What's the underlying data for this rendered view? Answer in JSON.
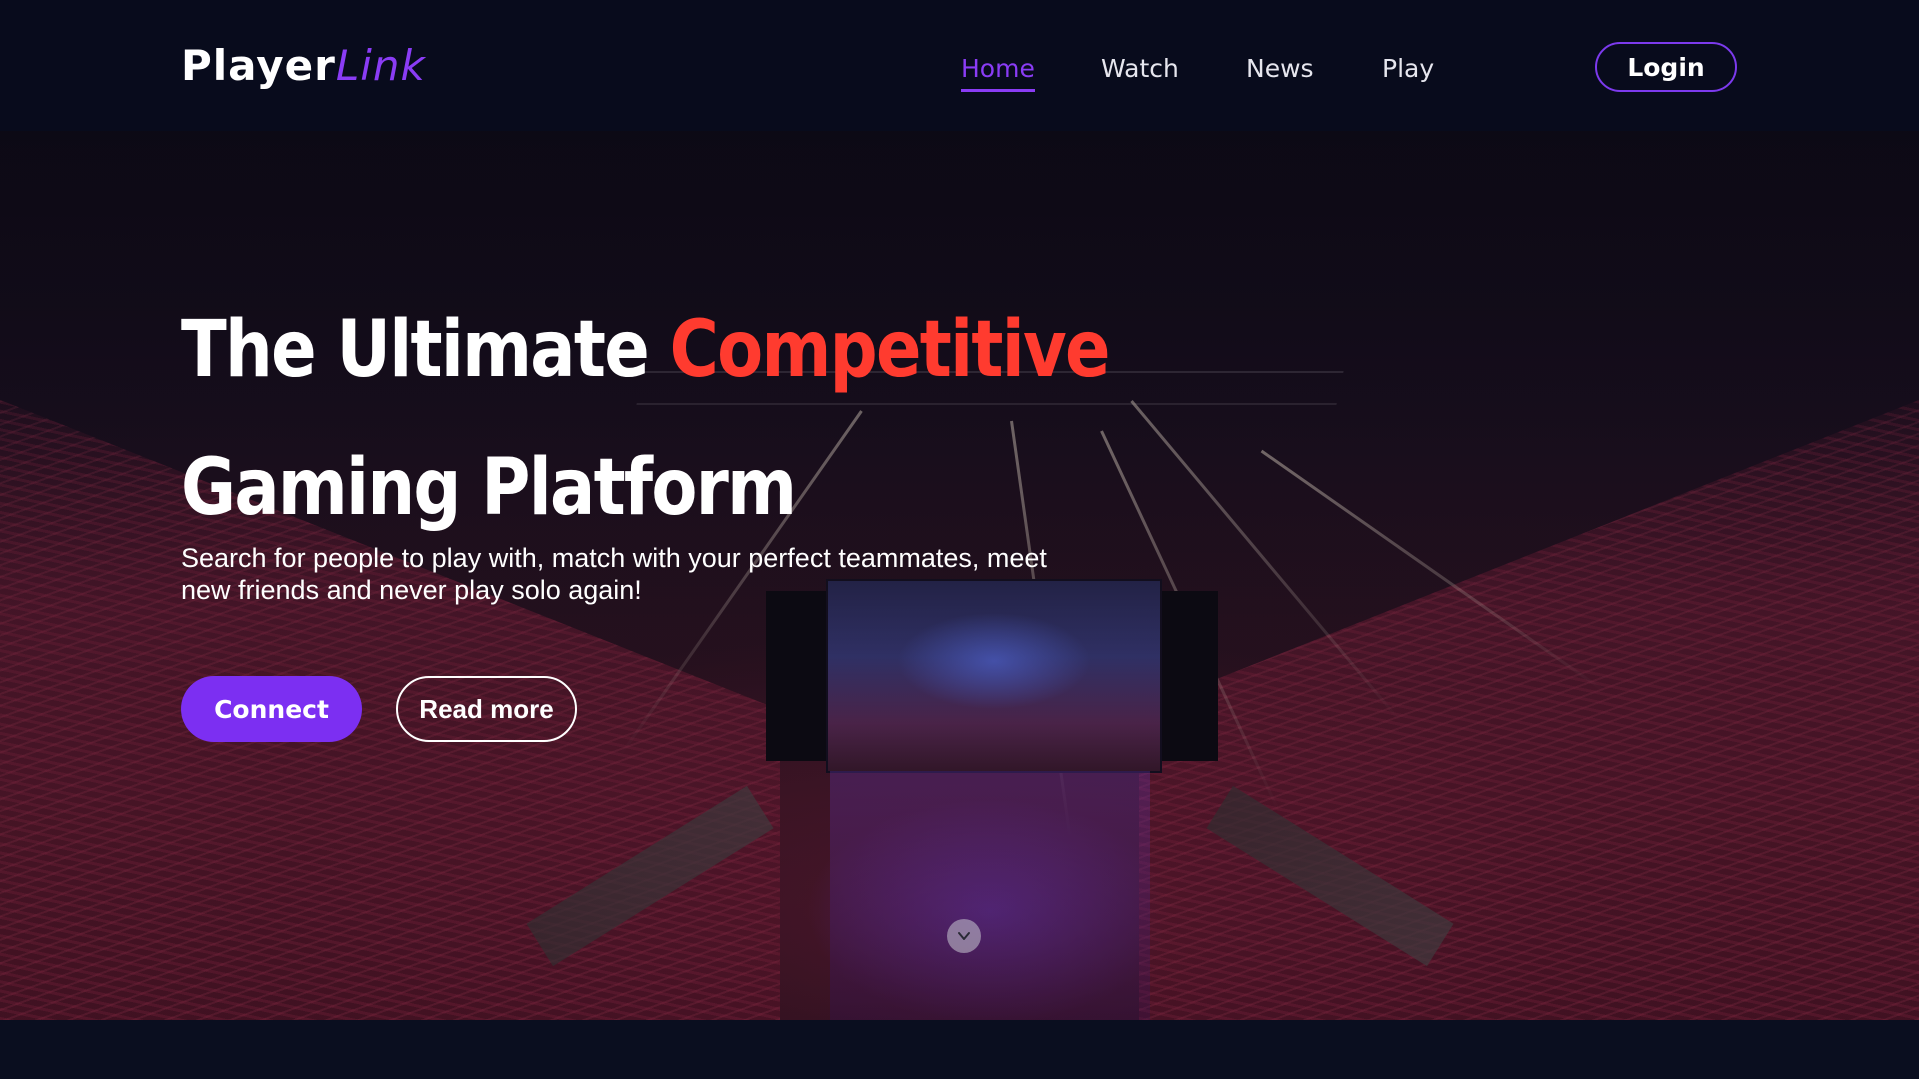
{
  "brand": {
    "name_part1": "Player",
    "name_part2": "Link",
    "accent_color": "#8a3cf5"
  },
  "nav": {
    "items": [
      {
        "label": "Home",
        "active": true
      },
      {
        "label": "Watch",
        "active": false
      },
      {
        "label": "News",
        "active": false
      },
      {
        "label": "Play",
        "active": false
      }
    ],
    "login_label": "Login"
  },
  "hero": {
    "title_part1": "The Ultimate ",
    "title_accent": "Competitive",
    "title_part2": "Gaming Platform",
    "title_accent_color": "#ff3b2f",
    "subtitle": "Search for people to play with, match with your perfect teammates, meet new friends and never play solo again!",
    "primary_button": "Connect",
    "secondary_button": "Read more",
    "scroll_icon": "chevron-down-icon"
  }
}
